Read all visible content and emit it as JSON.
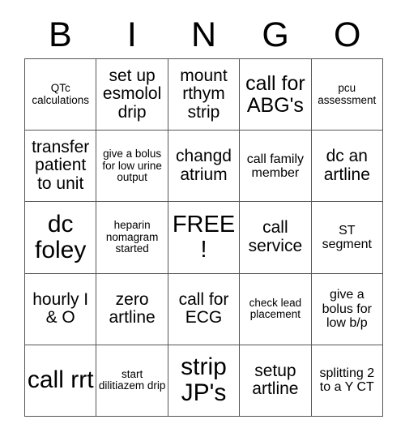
{
  "card": {
    "title": "BINGO",
    "header_letters": [
      "B",
      "I",
      "N",
      "G",
      "O"
    ],
    "free_space_label": "FREE!",
    "grid_line_color": "#555555",
    "text_color": "#000000",
    "background_color": "#ffffff",
    "rows": 5,
    "columns": 5,
    "cells": [
      [
        {
          "text": "QTc calculations",
          "size": "xs",
          "free": false
        },
        {
          "text": "set up esmolol drip",
          "size": "md",
          "free": false
        },
        {
          "text": "mount rthym strip",
          "size": "md",
          "free": false
        },
        {
          "text": "call for ABG's",
          "size": "lg",
          "free": false
        },
        {
          "text": "pcu assessment",
          "size": "xs",
          "free": false
        }
      ],
      [
        {
          "text": "transfer patient to unit",
          "size": "md",
          "free": false
        },
        {
          "text": "give a bolus for low urine output",
          "size": "xs",
          "free": false
        },
        {
          "text": "changd atrium",
          "size": "md",
          "free": false
        },
        {
          "text": "call family member",
          "size": "sm",
          "free": false
        },
        {
          "text": "dc an artline",
          "size": "md",
          "free": false
        }
      ],
      [
        {
          "text": "dc foley",
          "size": "xl",
          "free": false
        },
        {
          "text": "heparin nomagram started",
          "size": "xs",
          "free": false
        },
        {
          "text": "FREE!",
          "size": "lg",
          "free": true
        },
        {
          "text": "call service",
          "size": "md",
          "free": false
        },
        {
          "text": "ST segment",
          "size": "sm",
          "free": false
        }
      ],
      [
        {
          "text": "hourly I & O",
          "size": "md",
          "free": false
        },
        {
          "text": "zero artline",
          "size": "md",
          "free": false
        },
        {
          "text": "call for ECG",
          "size": "md",
          "free": false
        },
        {
          "text": "check lead placement",
          "size": "xs",
          "free": false
        },
        {
          "text": "give a bolus for low b/p",
          "size": "sm",
          "free": false
        }
      ],
      [
        {
          "text": "call rrt",
          "size": "xl",
          "free": false
        },
        {
          "text": "start dilitiazem drip",
          "size": "xs",
          "free": false
        },
        {
          "text": "strip JP's",
          "size": "xl",
          "free": false
        },
        {
          "text": "setup artline",
          "size": "md",
          "free": false
        },
        {
          "text": "splitting 2 to a Y CT",
          "size": "sm",
          "free": false
        }
      ]
    ]
  }
}
